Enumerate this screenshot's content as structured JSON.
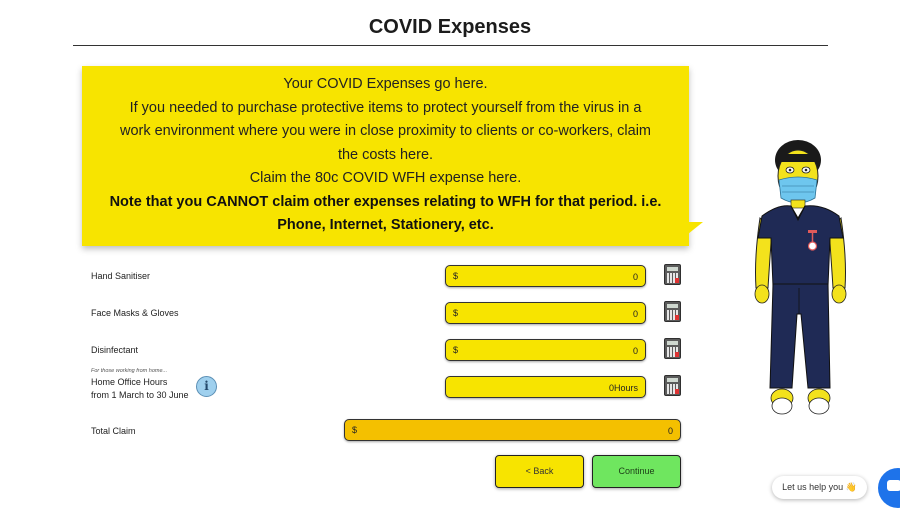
{
  "page": {
    "title": "COVID Expenses"
  },
  "info_bubble": {
    "lines": [
      "Your COVID Expenses go here.",
      "If you needed to purchase protective items to protect yourself from the virus in a",
      "work environment where you were in close proximity to clients or co-workers, claim",
      "the costs here.",
      "Claim the 80c COVID WFH expense here."
    ],
    "bold_lines": [
      "Note that you CANNOT claim other expenses relating to WFH for that period. i.e.",
      "Phone, Internet, Stationery, etc."
    ]
  },
  "rows": [
    {
      "label": "Hand Sanitiser",
      "currency": "$",
      "value": "0"
    },
    {
      "label": "Face Masks & Gloves",
      "currency": "$",
      "value": "0"
    },
    {
      "label": "Disinfectant",
      "currency": "$",
      "value": "0"
    }
  ],
  "home_office": {
    "note": "For those working from home...",
    "label_line1": "Home Office Hours",
    "label_line2": "from 1 March to 30 June",
    "value": "0Hours",
    "info_icon": "i"
  },
  "total": {
    "label": "Total Claim",
    "currency": "$",
    "value": "0"
  },
  "buttons": {
    "back": "< Back",
    "continue": "Continue"
  },
  "chat": {
    "label": "Let us help you 👋"
  },
  "colors": {
    "field": "#f7e400",
    "total_field": "#f4c000",
    "continue": "#6fe65f",
    "chat": "#1e73ea"
  },
  "icons": [
    "calculator-icon",
    "info-icon",
    "chat-icon",
    "nurse-illustration"
  ]
}
